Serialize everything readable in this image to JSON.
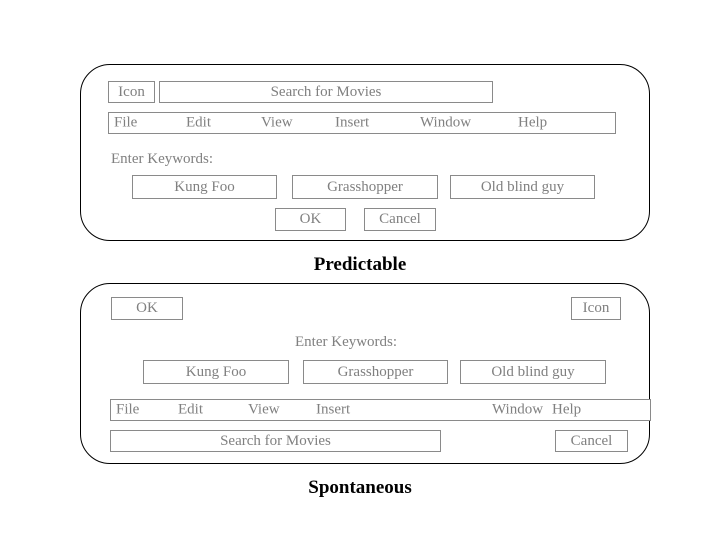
{
  "figure": {
    "panels": [
      {
        "id": "predictable",
        "caption": "Predictable",
        "widgets": {
          "icon_box": "Icon",
          "search_box": "Search for Movies",
          "menu_items": [
            "File",
            "Edit",
            "View",
            "Insert",
            "Window",
            "Help"
          ],
          "keywords_label": "Enter Keywords:",
          "keyword_buttons": [
            "Kung Foo",
            "Grasshopper",
            "Old blind guy"
          ],
          "ok_button": "OK",
          "cancel_button": "Cancel"
        }
      },
      {
        "id": "spontaneous",
        "caption": "Spontaneous",
        "widgets": {
          "icon_box": "Icon",
          "search_box": "Search for Movies",
          "menu_items": [
            "File",
            "Edit",
            "View",
            "Insert",
            "Window",
            "Help"
          ],
          "keywords_label": "Enter Keywords:",
          "keyword_buttons": [
            "Kung Foo",
            "Grasshopper",
            "Old blind guy"
          ],
          "ok_button": "OK",
          "cancel_button": "Cancel"
        }
      }
    ],
    "colors": {
      "panel_border": "#000000",
      "widget_border": "#8a8a8a",
      "widget_text": "#808080",
      "caption_text": "#000000",
      "background": "#ffffff"
    }
  }
}
